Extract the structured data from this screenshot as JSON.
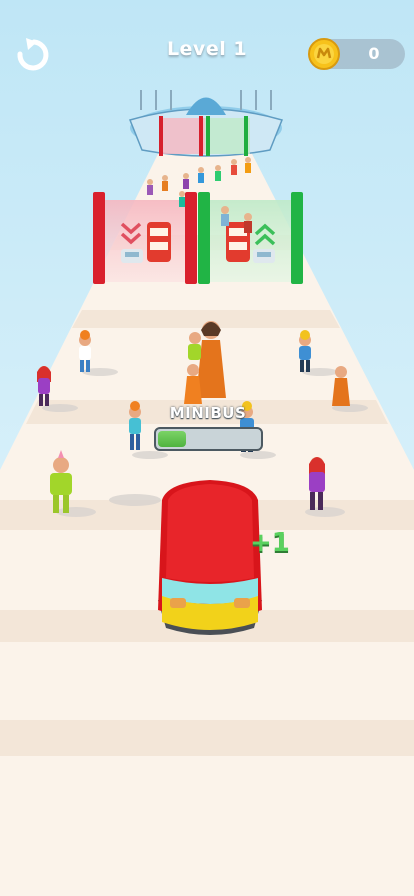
{
  "hud": {
    "level_title": "Level 1",
    "coin_count": "0",
    "restart_icon": "restart-arrow-icon",
    "coin_icon": "coin-icon"
  },
  "player": {
    "vehicle_label": "MINIBUS",
    "progress_fraction": 0.3,
    "plus_label": "+1",
    "vehicle_color": "#e8171c"
  },
  "gates": {
    "left": {
      "arrow": "down-chevrons-icon",
      "vehicles": [
        "bus-icon",
        "car-icon"
      ],
      "color": "#e02430"
    },
    "right": {
      "arrow": "up-chevrons-icon",
      "vehicles": [
        "bus-icon",
        "car-icon"
      ],
      "color": "#22b544"
    }
  },
  "colors": {
    "sky": "#dff3fb",
    "road": "#fbf3ea",
    "coin": "#f7c21b",
    "progress": "#5fc44e"
  }
}
